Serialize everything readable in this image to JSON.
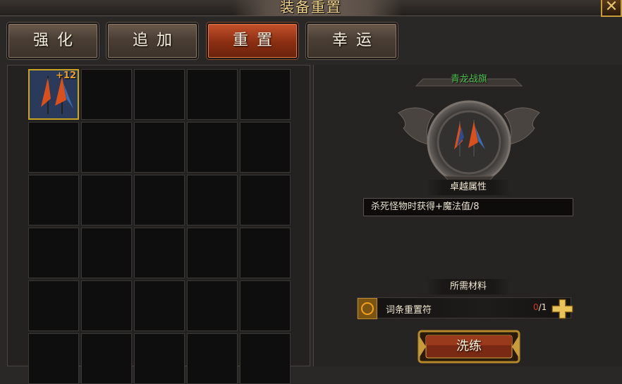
{
  "window": {
    "title": "装备重置",
    "close_glyph": "✕"
  },
  "tabs": [
    {
      "label": "强化",
      "active": false
    },
    {
      "label": "追加",
      "active": false
    },
    {
      "label": "重置",
      "active": true
    },
    {
      "label": "幸运",
      "active": false
    }
  ],
  "inventory": {
    "selected_item": {
      "name": "青龙战旗",
      "level": "+12",
      "icon": "war-banner-icon"
    }
  },
  "detail": {
    "item_name": "青龙战旗",
    "attr_section_label": "卓越属性",
    "attr_value": "杀死怪物时获得+魔法值/8",
    "material_section_label": "所需材料",
    "material": {
      "name": "词条重置符",
      "have": "0",
      "need": "/1",
      "icon": "reset-rune-icon"
    },
    "action_label": "洗练"
  },
  "colors": {
    "accent_gold": "#c9a322",
    "active_tab": "#c4512a",
    "item_name_green": "#4fc24f",
    "count_red": "#d03a2a"
  }
}
